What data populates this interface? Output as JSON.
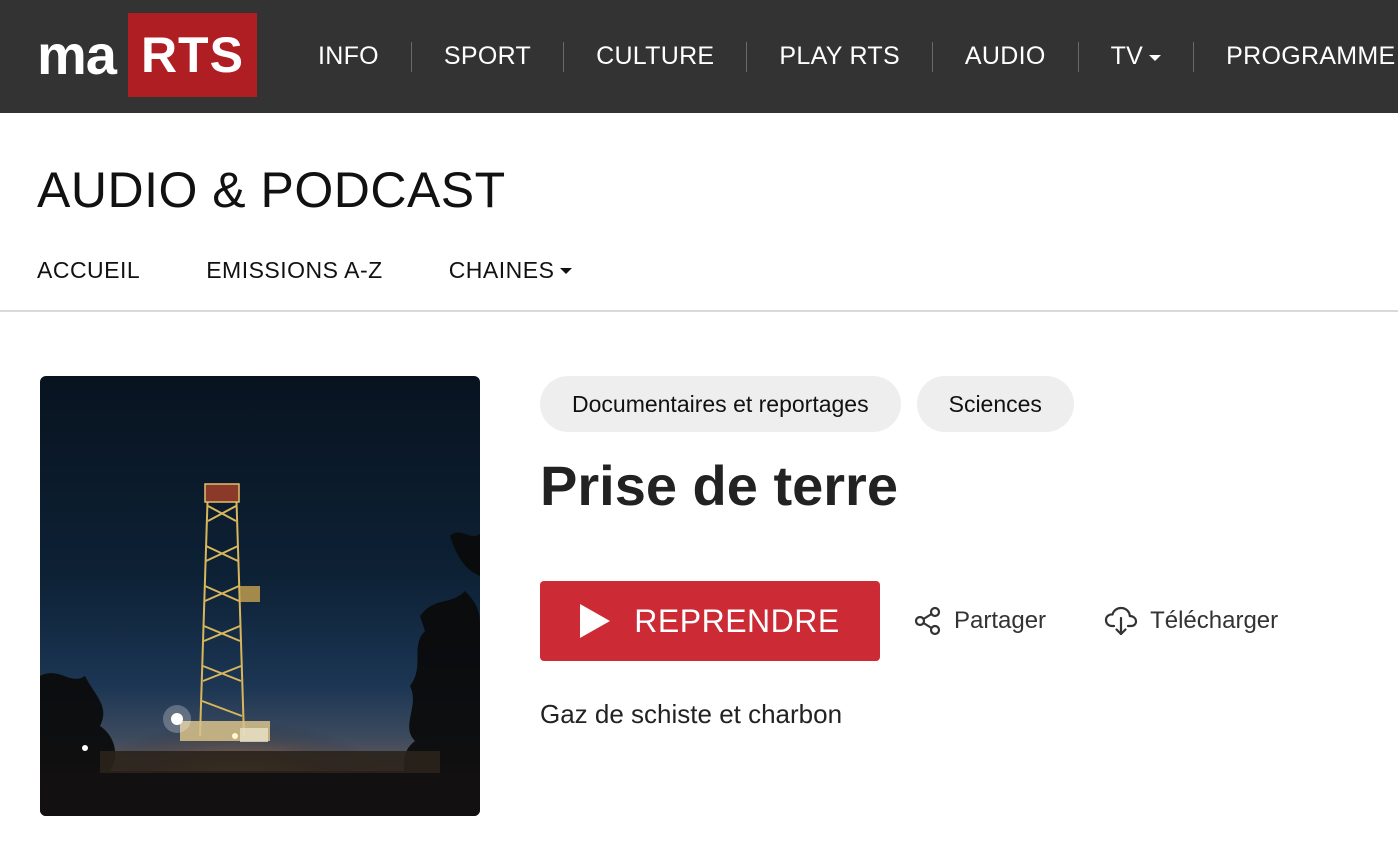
{
  "brand": {
    "logo_ma": "ma",
    "logo_rts": "RTS",
    "accent_color": "#af1e23"
  },
  "topnav": {
    "items": [
      {
        "label": "INFO"
      },
      {
        "label": "SPORT"
      },
      {
        "label": "CULTURE"
      },
      {
        "label": "PLAY RTS"
      },
      {
        "label": "AUDIO"
      },
      {
        "label": "TV",
        "has_dropdown": true
      },
      {
        "label": "PROGRAMME T"
      }
    ]
  },
  "section": {
    "title": "AUDIO & PODCAST",
    "subnav": [
      {
        "label": "ACCUEIL"
      },
      {
        "label": "EMISSIONS A-Z"
      },
      {
        "label": "CHAINES",
        "has_dropdown": true
      }
    ]
  },
  "show": {
    "tags": [
      "Documentaires et reportages",
      "Sciences"
    ],
    "title": "Prise de terre",
    "play_label": "REPRENDRE",
    "share_label": "Partager",
    "download_label": "Télécharger",
    "episode_title": "Gaz de schiste et charbon",
    "play_color": "#cc2b35",
    "icons": {
      "play": "play-icon",
      "share": "share-icon",
      "download": "cloud-download-icon"
    }
  }
}
